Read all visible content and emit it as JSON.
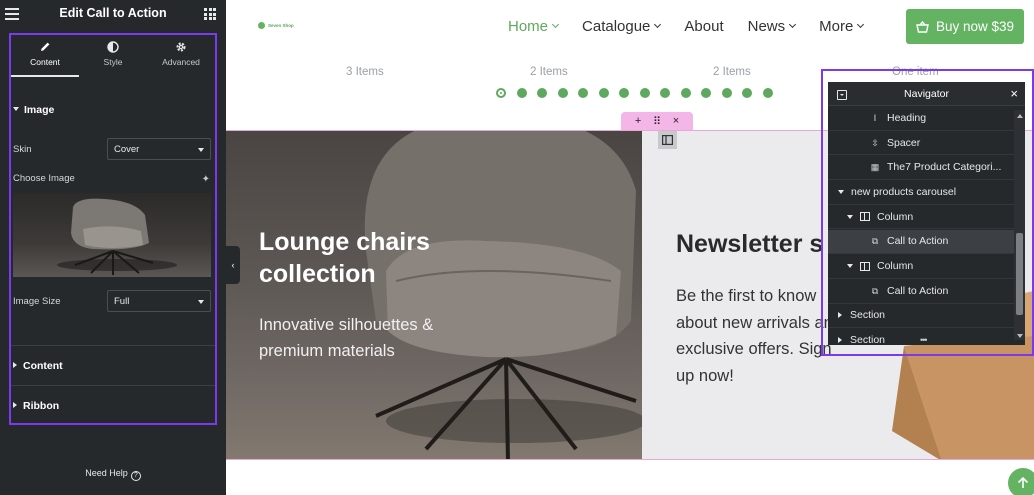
{
  "panel": {
    "title": "Edit Call to Action",
    "tabs": [
      {
        "label": "Content",
        "icon": "pencil-icon"
      },
      {
        "label": "Style",
        "icon": "half-circle-icon"
      },
      {
        "label": "Advanced",
        "icon": "gear-icon"
      }
    ],
    "image_section": "Image",
    "skin_label": "Skin",
    "skin_value": "Cover",
    "choose_image_label": "Choose Image",
    "image_size_label": "Image Size",
    "image_size_value": "Full",
    "content_section": "Content",
    "ribbon_section": "Ribbon",
    "help": "Need Help",
    "help_glyph": "?",
    "collapse_glyph": "‹"
  },
  "header": {
    "logo_text": "Seven Shop",
    "nav": [
      {
        "label": "Home",
        "dropdown": true,
        "active": true
      },
      {
        "label": "Catalogue",
        "dropdown": true
      },
      {
        "label": "About",
        "dropdown": false
      },
      {
        "label": "News",
        "dropdown": true
      },
      {
        "label": "More",
        "dropdown": true
      }
    ],
    "buy_label": "Buy now $39"
  },
  "strip": {
    "counts": [
      "3 Items",
      "2 Items",
      "2 Items",
      "One item"
    ],
    "dot_count": 14,
    "active_dot": 0
  },
  "edit_handle": {
    "add": "+",
    "drag": "⠿",
    "close": "×"
  },
  "hero": {
    "title": "Lounge chairs collection",
    "subtitle": "Innovative silhouettes & premium materials"
  },
  "newsletter": {
    "title": "Newsletter s",
    "body": "Be the first to know about new arrivals and exclusive offers. Sign up now!"
  },
  "navigator": {
    "title": "Navigator",
    "close": "×",
    "resize": "•••",
    "rows": [
      {
        "label": "Heading",
        "indent": 42,
        "icon": "heading"
      },
      {
        "label": "Spacer",
        "indent": 42,
        "icon": "spacer"
      },
      {
        "label": "The7 Product Categori...",
        "indent": 42,
        "icon": "grid"
      },
      {
        "label": "new products carousel",
        "indent": 10,
        "icon": "caret-down"
      },
      {
        "label": "Column",
        "indent": 19,
        "icon": "column-open"
      },
      {
        "label": "Call to Action",
        "indent": 42,
        "icon": "cta",
        "selected": true
      },
      {
        "label": "Column",
        "indent": 19,
        "icon": "column-open"
      },
      {
        "label": "Call to Action",
        "indent": 42,
        "icon": "cta"
      },
      {
        "label": "Section",
        "indent": 10,
        "icon": "caret-right"
      },
      {
        "label": "Section",
        "indent": 10,
        "icon": "caret-right"
      }
    ]
  },
  "colors": {
    "accent_green": "#63b363",
    "panel_bg": "#26292c",
    "highlight_purple": "#7c3aed",
    "edit_pink": "#f4b6e6"
  }
}
